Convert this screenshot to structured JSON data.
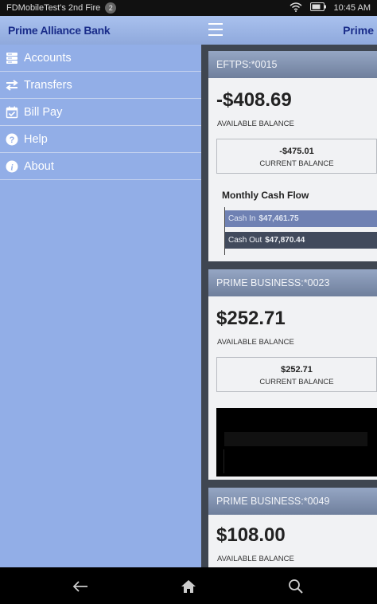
{
  "status_bar": {
    "device_name": "FDMobileTest's 2nd Fire",
    "notification_count": "2",
    "time": "10:45 AM"
  },
  "app_bar": {
    "brand": "Prime Alliance Bank",
    "brand_right": "Prime"
  },
  "drawer": {
    "items": [
      {
        "label": "Accounts",
        "icon": "accounts-icon"
      },
      {
        "label": "Transfers",
        "icon": "transfers-icon"
      },
      {
        "label": "Bill Pay",
        "icon": "bill-pay-icon"
      },
      {
        "label": "Help",
        "icon": "help-icon"
      },
      {
        "label": "About",
        "icon": "about-icon"
      }
    ]
  },
  "accounts": [
    {
      "name": "EFTPS:*0015",
      "available_balance": "-$408.69",
      "available_label": "AVAILABLE BALANCE",
      "current_balance": "-$475.01",
      "current_label": "CURRENT BALANCE",
      "cash_flow": {
        "title": "Monthly Cash Flow",
        "cash_in_label": "Cash In",
        "cash_in_value": "$47,461.75",
        "cash_out_label": "Cash Out",
        "cash_out_value": "$47,870.44"
      }
    },
    {
      "name": "PRIME BUSINESS:*0023",
      "available_balance": "$252.71",
      "available_label": "AVAILABLE BALANCE",
      "current_balance": "$252.71",
      "current_label": "CURRENT BALANCE"
    },
    {
      "name": "PRIME BUSINESS:*0049",
      "available_balance": "$108.00",
      "available_label": "AVAILABLE BALANCE"
    }
  ],
  "colors": {
    "drawer_bg": "#92aee7",
    "brand_text": "#1a2d8a",
    "cash_in_bar": "#6f81b3",
    "cash_out_bar": "#414a5c"
  }
}
